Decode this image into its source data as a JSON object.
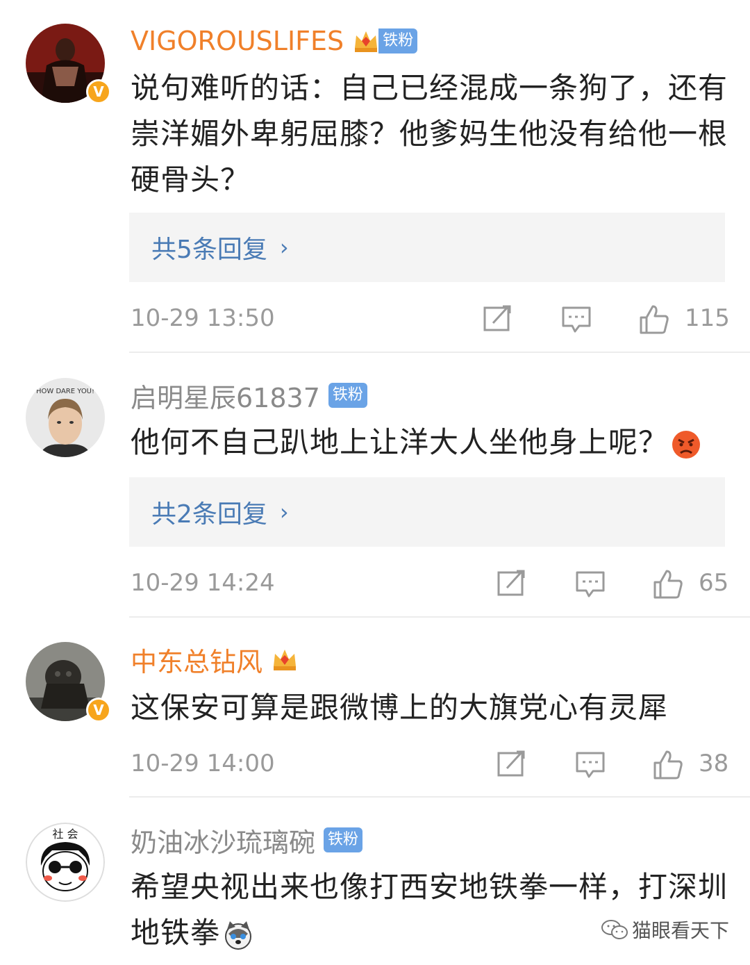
{
  "comments": [
    {
      "username": "VIGOROUSLIFES",
      "fan_badge": "铁粉",
      "text": "说句难听的话：自己已经混成一条狗了，还有崇洋媚外卑躬屈膝？他爹妈生他没有给他一根硬骨头？",
      "replies_label": "共5条回复",
      "time": "10-29 13:50",
      "likes": "115",
      "crown_level": "5"
    },
    {
      "username": "启明星辰61837",
      "fan_badge": "铁粉",
      "avatar_caption": "HOW DARE YOU!",
      "text": "他何不自己趴地上让洋大人坐他身上呢？",
      "replies_label": "共2条回复",
      "time": "10-29 14:24",
      "likes": "65"
    },
    {
      "username": "中东总钻风",
      "text": "这保安可算是跟微博上的大旗党心有灵犀",
      "time": "10-29 14:00",
      "likes": "38",
      "crown_level": "2"
    },
    {
      "username": "奶油冰沙琉璃碗",
      "fan_badge": "铁粉",
      "avatar_caption": "社 会",
      "text": "希望央视出来也像打西安地铁拳一样，打深圳地铁拳"
    }
  ],
  "watermark": "猫眼看天下",
  "colors": {
    "vip_name": "#f0802a",
    "plain_name": "#8a8a8a",
    "link_blue": "#4a7bb5",
    "fan_badge_bg": "#6aa3e6",
    "verified": "#f7a51c"
  }
}
